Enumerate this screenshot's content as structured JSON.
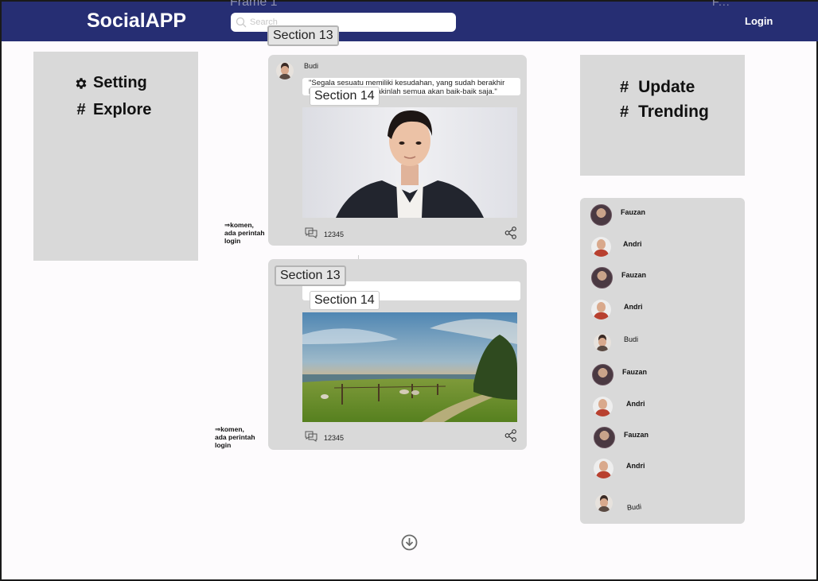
{
  "header": {
    "brand": "SocialAPP",
    "frame_label": "Frame 1",
    "frame_dots": "F...",
    "search": {
      "placeholder": "Search",
      "value": "",
      "icon": "search-icon"
    },
    "login_label": "Login",
    "background_color": "#262e73"
  },
  "left_menu": {
    "items": [
      {
        "label": "Setting",
        "icon": "gear-icon"
      },
      {
        "label": "Explore",
        "icon": "hash-icon",
        "glyph": "#"
      }
    ]
  },
  "right_tags": {
    "items": [
      {
        "glyph": "#",
        "label": "Update"
      },
      {
        "glyph": "#",
        "label": "Trending"
      }
    ]
  },
  "users": [
    {
      "name": "Fauzan",
      "avatar": "avatar-dark"
    },
    {
      "name": "Andri",
      "avatar": "avatar-red"
    },
    {
      "name": "Fauzan",
      "avatar": "avatar-dark"
    },
    {
      "name": "Andri",
      "avatar": "avatar-red"
    },
    {
      "name": "Budi",
      "avatar": "avatar-small"
    },
    {
      "name": "Fauzan",
      "avatar": "avatar-dark"
    },
    {
      "name": "Andri",
      "avatar": "avatar-red"
    },
    {
      "name": "Fauzan",
      "avatar": "avatar-dark"
    },
    {
      "name": "Andri",
      "avatar": "avatar-red"
    },
    {
      "name": "Budi",
      "avatar": "avatar-small"
    }
  ],
  "posts": [
    {
      "user": "Budi",
      "caption_line1": "\"Segala sesuatu memiliki kesudahan, yang sudah berakhir",
      "caption_line2": "biarlah berlalu dan yakinlah semua akan baik-baik saja.\"",
      "image": "portrait-photo",
      "comment_count": "12345",
      "section_outer": "Section 13",
      "section_inner": "Section 14",
      "note": [
        "⇒komen,",
        "ada perintah",
        "login"
      ]
    },
    {
      "user": "",
      "caption_line1": "",
      "caption_line2": "",
      "image": "landscape-photo",
      "comment_count": "12345",
      "section_outer": "Section 13",
      "section_inner": "Section 14",
      "note": [
        "⇒komen,",
        "ada perintah",
        "login"
      ]
    }
  ],
  "footer": {
    "icon": "scroll-down-icon"
  }
}
